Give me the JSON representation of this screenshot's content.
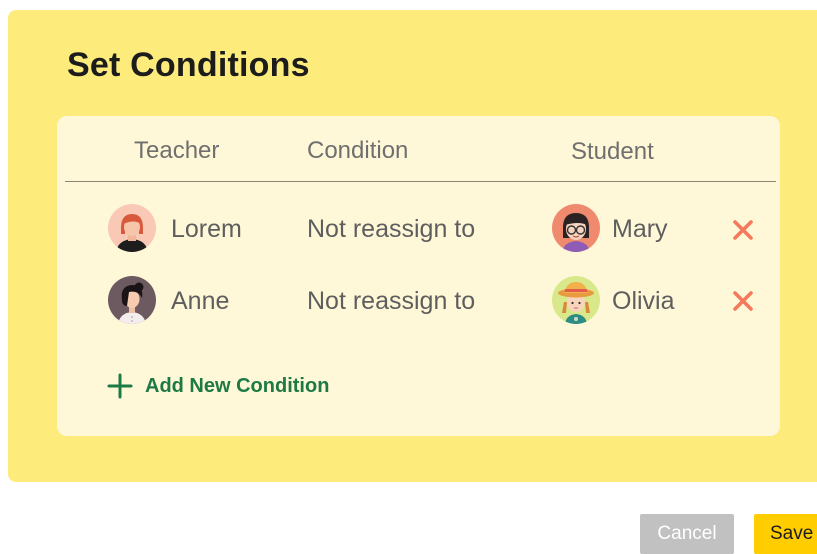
{
  "dialog": {
    "title": "Set Conditions"
  },
  "table": {
    "headers": {
      "teacher": "Teacher",
      "condition": "Condition",
      "student": "Student"
    },
    "rows": [
      {
        "teacher": "Lorem",
        "condition": "Not reassign to",
        "student": "Mary"
      },
      {
        "teacher": "Anne",
        "condition": "Not reassign to",
        "student": "Olivia"
      }
    ],
    "remove_icon": "close-x-icon"
  },
  "add_condition": {
    "label": "Add New Condition",
    "icon": "plus-icon"
  },
  "footer": {
    "cancel_label": "Cancel",
    "save_label": "Save"
  },
  "colors": {
    "panel": "#fdec7b",
    "card": "#fff8d8",
    "remove": "#f47a5b",
    "add": "#1d7a45",
    "save": "#ffcd00",
    "cancel": "#c1c1c1"
  }
}
